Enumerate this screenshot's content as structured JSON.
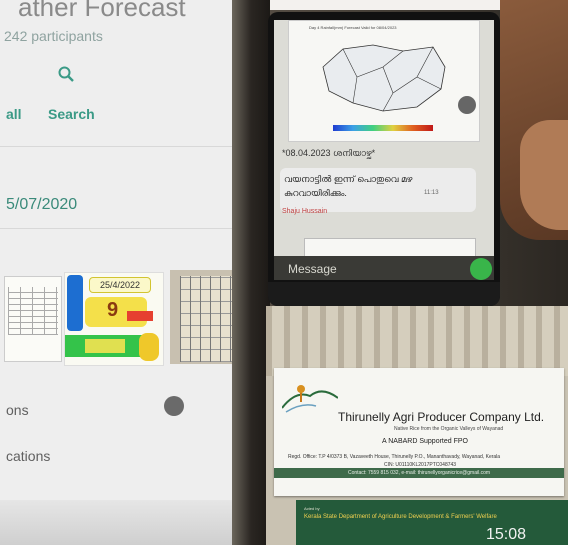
{
  "left_phone": {
    "title_fragment": "ather Forecast",
    "participants": "242 participants",
    "nav": {
      "call_label": "all",
      "search_label": "Search"
    },
    "date_fragment": "5/07/2020",
    "thumbnail_date": "25/4/2022",
    "thumbnail_number": "9",
    "option_1": "ons",
    "option_2": "cations"
  },
  "right_phone": {
    "map_title": "Day 4 Rainfall(mm) Forecast Valid for 08/04/2023",
    "message_date": "*08.04.2023 ശനിയാഴ്ച*",
    "message_line1": "വയനാട്ടിൽ ഇന്ന് പൊതുവെ മഴ",
    "message_line2": "കുറവായിരിക്കും.",
    "message_time": "11:13",
    "sender": "Shaju Hussain",
    "input_placeholder": "Message"
  },
  "card": {
    "company": "Thirunelly Agri Producer Company Ltd.",
    "tagline": "Native Rice from the Organic Valleys of Wayanad",
    "nabard": "A NABARD Supported FPO",
    "regd": "Regd. Office: T.P 4/0373 B, Vazaveeth House, Thirunelly P.O., Mananthavady, Wayanad, Kerala",
    "cin": "CIN: U01110KL2017PTC048743",
    "contact": "Contact: 7559 815 032, e-mail: thirunellyorganicrice@gmail.com"
  },
  "board": {
    "acted_by": "Acted by",
    "department": "Kerala State Department of Agriculture Development & Farmers' Welfare"
  },
  "status": {
    "clock": "15:08"
  }
}
